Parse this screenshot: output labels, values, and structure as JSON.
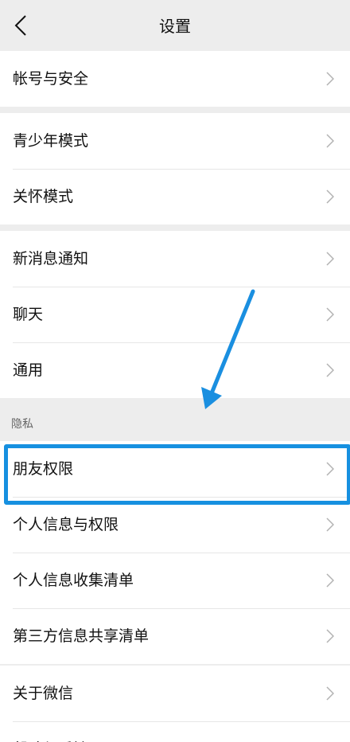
{
  "header": {
    "title": "设置"
  },
  "groups": [
    {
      "items": [
        "帐号与安全"
      ]
    },
    {
      "items": [
        "青少年模式",
        "关怀模式"
      ]
    },
    {
      "items": [
        "新消息通知",
        "聊天",
        "通用"
      ]
    },
    {
      "section_label": "隐私",
      "items": [
        "朋友权限",
        "个人信息与权限",
        "个人信息收集清单",
        "第三方信息共享清单"
      ]
    },
    {
      "items": [
        "关于微信",
        "帮助与反馈"
      ]
    }
  ],
  "annotation": {
    "highlight_color": "#1690e0",
    "arrow_color": "#1a8fe0"
  }
}
